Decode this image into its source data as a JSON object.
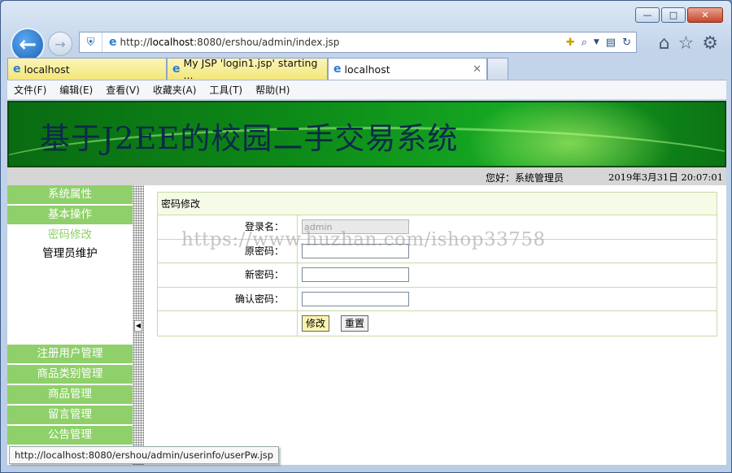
{
  "browser": {
    "address": {
      "prefix": "http://",
      "host": "localhost",
      "rest": ":8080/ershou/admin/index.jsp"
    },
    "tabs": [
      {
        "label": "localhost"
      },
      {
        "label": "My JSP 'login1.jsp' starting ..."
      },
      {
        "label": "localhost"
      }
    ],
    "menu": [
      "文件(F)",
      "编辑(E)",
      "查看(V)",
      "收藏夹(A)",
      "工具(T)",
      "帮助(H)"
    ],
    "status_url": "http://localhost:8080/ershou/admin/userinfo/userPw.jsp",
    "window_buttons": {
      "minimize": "—",
      "restore": "□",
      "close": "✕"
    }
  },
  "page": {
    "banner_title": "基于J2EE的校园二手交易系统",
    "greeting": "您好：系统管理员",
    "datetime": "2019年3月31日  20:07:01",
    "sidebar": {
      "top_items": [
        "系统属性",
        "基本操作"
      ],
      "sub_items": [
        "密码修改",
        "管理员维护"
      ],
      "bottom_items": [
        "注册用户管理",
        "商品类别管理",
        "商品管理",
        "留言管理",
        "公告管理"
      ]
    },
    "form": {
      "title": "密码修改",
      "username_label": "登录名：",
      "username_value": "admin",
      "old_pw_label": "原密码：",
      "new_pw_label": "新密码：",
      "confirm_pw_label": "确认密码：",
      "submit_label": "修改",
      "reset_label": "重置"
    },
    "watermark": "https://www.huzhan.com/ishop33758"
  }
}
